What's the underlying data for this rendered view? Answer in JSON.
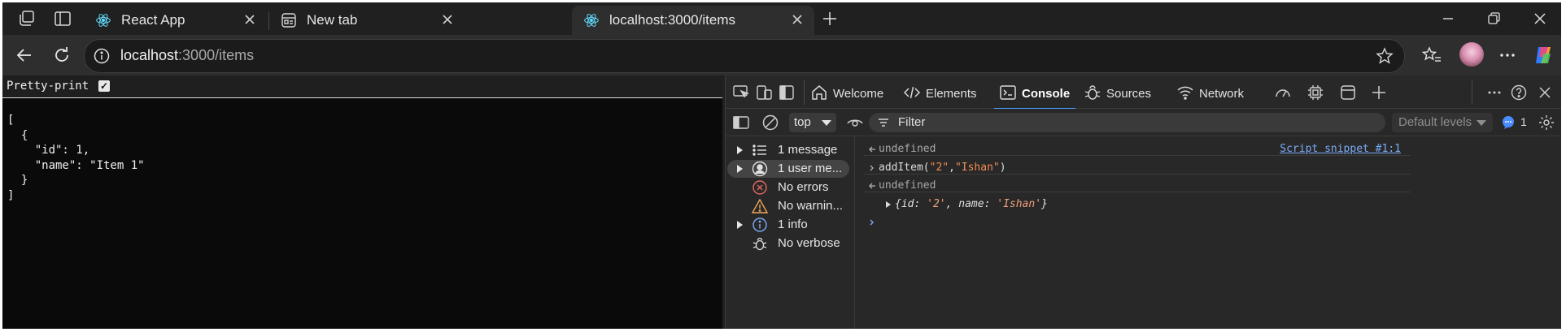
{
  "browser": {
    "tabs": [
      {
        "title": "React App",
        "icon": "react-icon",
        "active": false
      },
      {
        "title": "New tab",
        "icon": "newtab-icon",
        "active": false
      },
      {
        "title": "localhost:3000/items",
        "icon": "react-icon",
        "active": true
      }
    ],
    "address": {
      "host": "localhost",
      "rest": ":3000/items"
    }
  },
  "page": {
    "pretty_print_label": "Pretty-print",
    "pretty_print_checked": true,
    "json_lines": [
      "[",
      "  {",
      "    \"id\": 1,",
      "    \"name\": \"Item 1\"",
      "  }",
      "]"
    ]
  },
  "devtools": {
    "tabs": [
      {
        "label": "Welcome",
        "icon": "home-icon"
      },
      {
        "label": "Elements",
        "icon": "code-icon"
      },
      {
        "label": "Console",
        "icon": "console-icon",
        "active": true
      },
      {
        "label": "Sources",
        "icon": "bug-icon"
      },
      {
        "label": "Network",
        "icon": "wifi-icon"
      }
    ],
    "context": "top",
    "filter_placeholder": "Filter",
    "levels": "Default levels",
    "issues_count": "1",
    "sidebar": [
      {
        "label": "1 message",
        "icon": "list-icon",
        "expandable": true
      },
      {
        "label": "1 user me...",
        "icon": "user-icon",
        "expandable": true,
        "selected": true
      },
      {
        "label": "No errors",
        "icon": "error-icon",
        "expandable": false
      },
      {
        "label": "No warnin...",
        "icon": "warning-icon",
        "expandable": false
      },
      {
        "label": "1 info",
        "icon": "info-icon",
        "expandable": true
      },
      {
        "label": "No verbose",
        "icon": "bug-icon",
        "expandable": false
      }
    ],
    "console": {
      "line1": "undefined",
      "line1_source": "Script snippet #1:1",
      "cmd_fn": "addItem(",
      "cmd_arg1": "\"2\"",
      "cmd_comma": ",",
      "cmd_arg2": "\"Ishan\"",
      "cmd_close": ")",
      "line3": "undefined",
      "obj_open": "{id: ",
      "obj_id": "'2'",
      "obj_mid": ", name: ",
      "obj_name": "'Ishan'",
      "obj_close": "}"
    }
  }
}
